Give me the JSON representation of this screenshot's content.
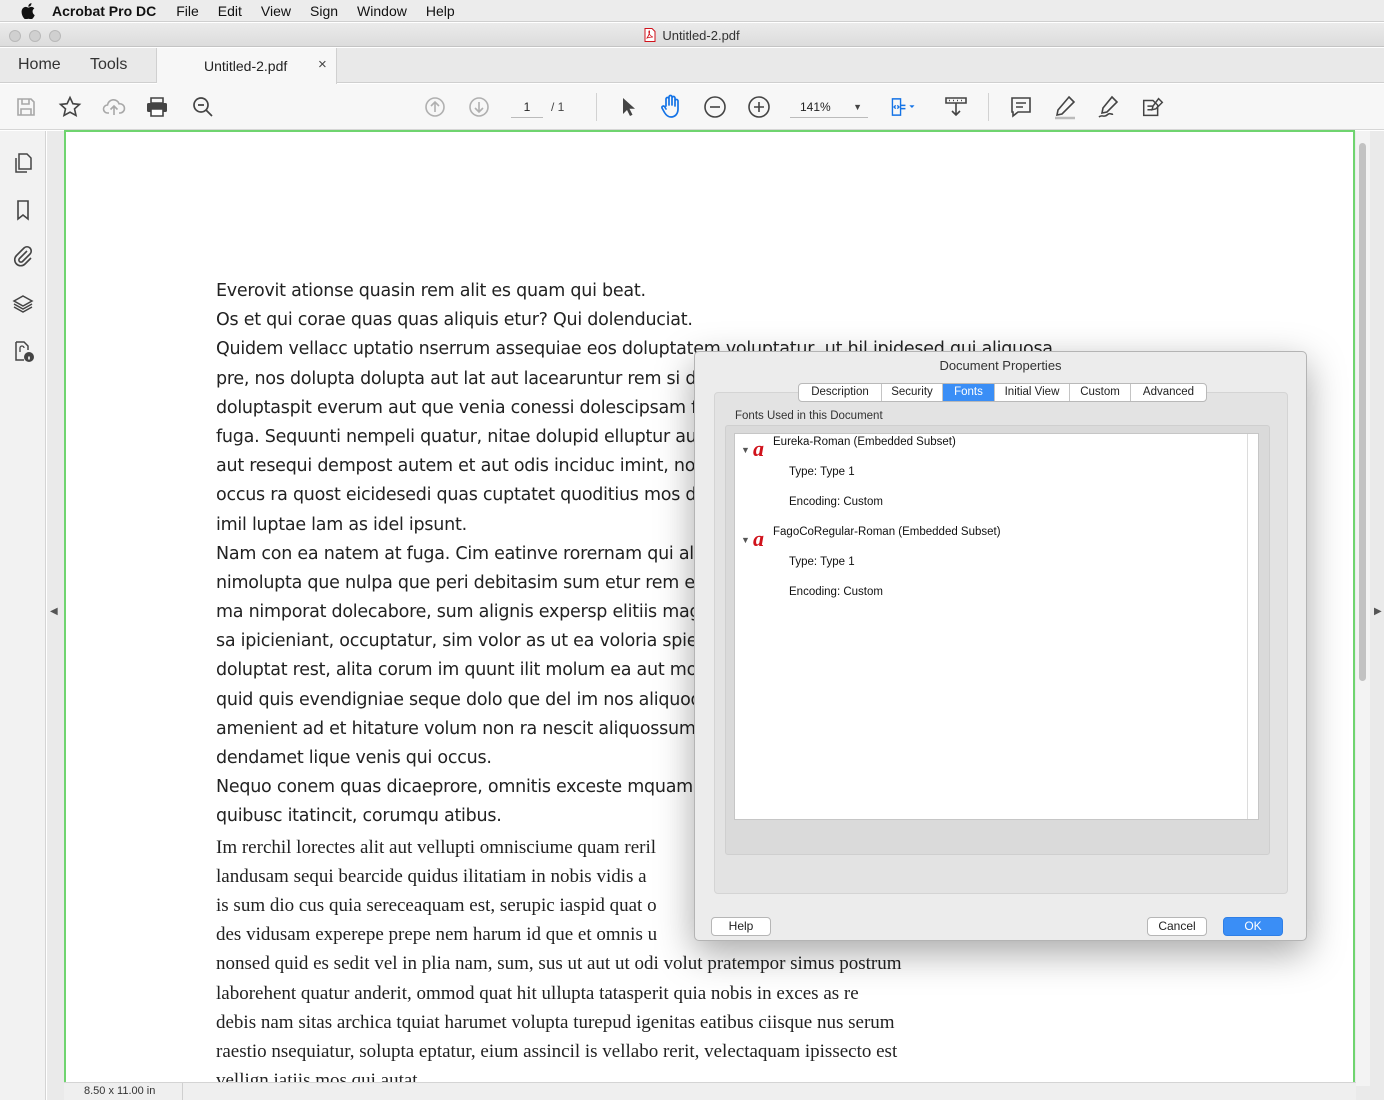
{
  "menubar": {
    "app": "Acrobat Pro DC",
    "items": [
      "File",
      "Edit",
      "View",
      "Sign",
      "Window",
      "Help"
    ]
  },
  "window": {
    "title": "Untitled-2.pdf"
  },
  "tabs": {
    "home": "Home",
    "tools": "Tools",
    "doc_tab": "Untitled-2.pdf",
    "close": "×"
  },
  "toolbar": {
    "page_current": "1",
    "page_total": "/ 1",
    "zoom": "141%",
    "zoom_arrow": "▼"
  },
  "status": {
    "page_size": "8.50 x 11.00 in"
  },
  "document": {
    "sans_lines": [
      "Everovit ationse quasin rem alit es quam qui beat.",
      "Os et qui corae quas quas aliquis etur? Qui dolenduciat.",
      "Quidem vellacc uptatio nserrum assequiae eos doluptatem voluptatur, ut hil ipidesed qui aliquosa",
      "pre, nos dolupta dolupta aut lat aut lacearuntur rem si dolo es",
      "doluptaspit everum aut que venia conessi dolescipsam facere ip",
      "fuga. Sequunti nempeli quatur, nitae dolupid elluptur aut est,",
      "aut resequi dempost autem et aut odis inciduc imint, nonecer",
      "occus ra quost eicidesedi quas cuptatet quoditius mos deritati s",
      "imil luptae lam as idel ipsunt.",
      "Nam con ea natem at fuga. Cim eatinve rorernam qui alitibusam",
      "nimolupta que nulpa que peri debitasim sum etur rem elis en",
      "ma nimporat dolecabore, sum alignis expersp elitiis magnam u",
      "sa ipicieniant, occuptatur, sim volor as ut ea voloria spientius a",
      "doluptat rest, alita corum im quunt ilit molum ea aut molute",
      "quid quis evendigniae seque dolo que del im nos aliquod quo",
      "amenient ad et hitature volum non ra nescit aliquossum nobis",
      "dendamet lique venis qui occus.",
      "Nequo conem quas dicaeprore, omnitis exceste mquam, odit,",
      "quibusc itatincit, corumqu atibus."
    ],
    "serif_lines": [
      "Im rerchil lorectes alit aut vellupti omnisciume quam reril",
      "landusam sequi bearcide quidus ilitatiam in nobis vidis a",
      "is sum dio cus quia sereceaquam est, serupic iaspid quat o",
      "des vidusam experepe prepe nem harum id que et omnis u",
      "nonsed quid es sedit vel in plia nam, sum, sus ut aut ut odi volut pratempor simus postrum",
      "laborehent quatur anderit, ommod quat hit ullupta tatasperit quia nobis in exces as re",
      "debis nam sitas archica tquiat harumet volupta turepud igenitas eatibus ciisque nus serum",
      "raestio nsequiatur, solupta eptatur, eium assincil is vellabo rerit, velectaquam ipissecto est",
      "vellign iatiis mos qui autat"
    ]
  },
  "dialog": {
    "title": "Document Properties",
    "tabs": [
      "Description",
      "Security",
      "Fonts",
      "Initial View",
      "Custom",
      "Advanced"
    ],
    "active_tab": "Fonts",
    "section_label": "Fonts Used in this Document",
    "fonts": [
      {
        "name": "Eureka-Roman (Embedded Subset)",
        "type": "Type: Type 1",
        "encoding": "Encoding: Custom"
      },
      {
        "name": "FagoCoRegular-Roman (Embedded Subset)",
        "type": "Type: Type 1",
        "encoding": "Encoding: Custom"
      }
    ],
    "help_button": "Help",
    "cancel_button": "Cancel",
    "ok_button": "OK"
  },
  "colors": {
    "accent": "#3a8ef6",
    "page_border": "#6fd46f",
    "font_icon_red": "#d0121b",
    "hand_tool_blue": "#1473e6"
  }
}
